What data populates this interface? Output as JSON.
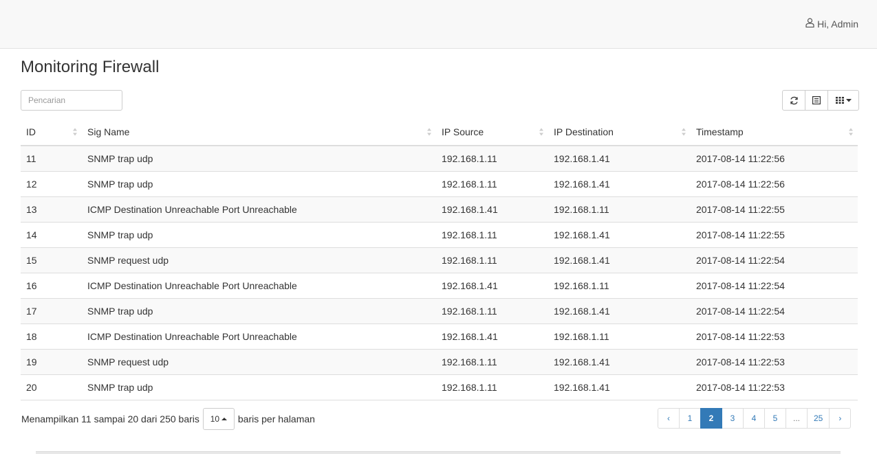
{
  "header": {
    "user_greeting": "Hi, Admin"
  },
  "page": {
    "title": "Monitoring Firewall"
  },
  "search": {
    "placeholder": "Pencarian"
  },
  "table": {
    "columns": [
      "ID",
      "Sig Name",
      "IP Source",
      "IP Destination",
      "Timestamp"
    ],
    "rows": [
      [
        "11",
        "SNMP trap udp",
        "192.168.1.11",
        "192.168.1.41",
        "2017-08-14 11:22:56"
      ],
      [
        "12",
        "SNMP trap udp",
        "192.168.1.11",
        "192.168.1.41",
        "2017-08-14 11:22:56"
      ],
      [
        "13",
        "ICMP Destination Unreachable Port Unreachable",
        "192.168.1.41",
        "192.168.1.11",
        "2017-08-14 11:22:55"
      ],
      [
        "14",
        "SNMP trap udp",
        "192.168.1.11",
        "192.168.1.41",
        "2017-08-14 11:22:55"
      ],
      [
        "15",
        "SNMP request udp",
        "192.168.1.11",
        "192.168.1.41",
        "2017-08-14 11:22:54"
      ],
      [
        "16",
        "ICMP Destination Unreachable Port Unreachable",
        "192.168.1.41",
        "192.168.1.11",
        "2017-08-14 11:22:54"
      ],
      [
        "17",
        "SNMP trap udp",
        "192.168.1.11",
        "192.168.1.41",
        "2017-08-14 11:22:54"
      ],
      [
        "18",
        "ICMP Destination Unreachable Port Unreachable",
        "192.168.1.41",
        "192.168.1.11",
        "2017-08-14 11:22:53"
      ],
      [
        "19",
        "SNMP request udp",
        "192.168.1.11",
        "192.168.1.41",
        "2017-08-14 11:22:53"
      ],
      [
        "20",
        "SNMP trap udp",
        "192.168.1.11",
        "192.168.1.41",
        "2017-08-14 11:22:53"
      ]
    ]
  },
  "footer": {
    "info_prefix": "Menampilkan 11 sampai 20 dari 250 baris",
    "page_size": "10",
    "info_suffix": "baris per halaman"
  },
  "pagination": {
    "prev": "‹",
    "pages": [
      "1",
      "2",
      "3",
      "4",
      "5",
      "...",
      "25"
    ],
    "active": "2",
    "next": "›"
  },
  "colors": {
    "accent": "#337ab7",
    "topbar": "#f8f8f8",
    "stripe": "#f9f9f9"
  },
  "icons": {
    "user": "user-icon",
    "refresh": "refresh-icon",
    "list_view": "list-view-icon",
    "columns": "columns-grid-icon",
    "sort": "sort-both-icon"
  }
}
